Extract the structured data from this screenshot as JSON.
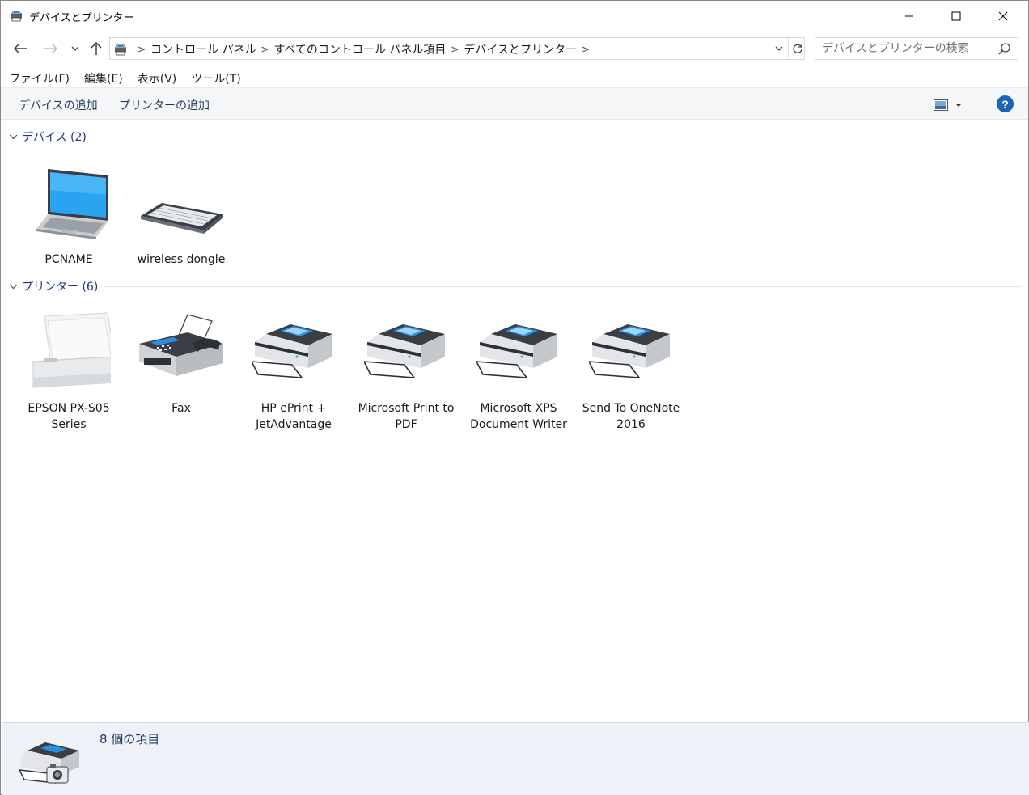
{
  "window": {
    "title": "デバイスとプリンター",
    "accent": "#1c64b8"
  },
  "address_bar": {
    "breadcrumbs": [
      "コントロール パネル",
      "すべてのコントロール パネル項目",
      "デバイスとプリンター"
    ]
  },
  "search": {
    "placeholder": "デバイスとプリンターの検索"
  },
  "menu": [
    "ファイル(F)",
    "編集(E)",
    "表示(V)",
    "ツール(T)"
  ],
  "commands": {
    "add_device": "デバイスの追加",
    "add_printer": "プリンターの追加",
    "help": "?"
  },
  "groups": {
    "devices": {
      "label": "デバイス (2)",
      "items": [
        {
          "label": "PCNAME",
          "icon": "laptop-icon"
        },
        {
          "label": "wireless dongle",
          "icon": "keyboard-icon"
        }
      ]
    },
    "printers": {
      "label": "プリンター (6)",
      "items": [
        {
          "label": "EPSON PX-S05 Series",
          "icon": "portable-printer-icon"
        },
        {
          "label": "Fax",
          "icon": "fax-icon"
        },
        {
          "label": "HP ePrint + JetAdvantage",
          "icon": "printer-icon"
        },
        {
          "label": "Microsoft Print to PDF",
          "icon": "printer-icon"
        },
        {
          "label": "Microsoft XPS Document Writer",
          "icon": "printer-icon"
        },
        {
          "label": "Send To OneNote 2016",
          "icon": "printer-icon"
        }
      ]
    }
  },
  "details": {
    "count_text": "8 個の項目"
  }
}
